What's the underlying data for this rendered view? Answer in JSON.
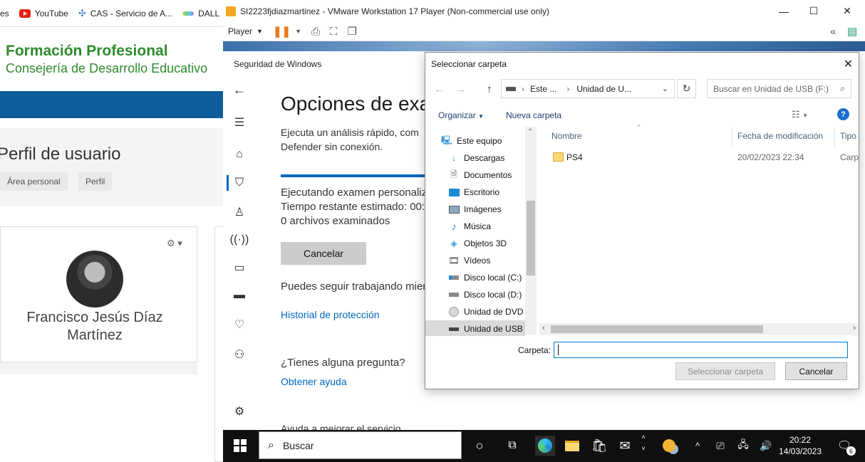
{
  "browser": {
    "bookmarks": [
      {
        "label": "es",
        "icon": "none",
        "color": ""
      },
      {
        "label": "YouTube",
        "icon": "youtube-icon",
        "color": "#e62117"
      },
      {
        "label": "CAS - Servicio de A...",
        "icon": "cas-icon",
        "color": "#3a7bd5"
      },
      {
        "label": "DALL",
        "icon": "dall-icon",
        "color": "#f2c94c"
      }
    ],
    "org_title": "Formación Profesional",
    "org_subtitle": "Consejería de Desarrollo Educativo",
    "page_title": "Perfil de usuario",
    "breadcrumb": [
      "Área personal",
      "Perfil"
    ],
    "user_name": "Francisco Jesús Díaz Martínez",
    "brand_color": "#2e8b2e",
    "nav_color": "#0f5c9c"
  },
  "vmware": {
    "title": "SI2223fjdiazmartinez - VMware Workstation 17 Player (Non-commercial use only)",
    "player_menu": "Player",
    "controls": {
      "minimize": "—",
      "maximize": "☐",
      "close": "✕"
    },
    "collapse_icon": "«"
  },
  "winsec": {
    "window_title": "Seguridad de Windows",
    "heading": "Opciones de exam",
    "description_line1": "Ejecuta un análisis rápido, com",
    "description_line2": "Defender sin conexión.",
    "status_line1": "Ejecutando examen personaliz",
    "status_line2": "Tiempo restante estimado: 00:0",
    "status_line3": "0  archivos examinados",
    "cancel_button": "Cancelar",
    "continue_text": "Puedes seguir trabajando mien",
    "history_link": "Historial de protección",
    "question": "¿Tienes alguna pregunta?",
    "help_link": "Obtener ayuda",
    "improve_text": "Ayuda a mejorar el servicio",
    "accent": "#0067c0"
  },
  "dialog": {
    "title": "Seleccionar carpeta",
    "address": {
      "drive_icon": "usb-drive-icon",
      "seg1": "Este ...",
      "seg2": "Unidad de U..."
    },
    "search_placeholder": "Buscar en Unidad de USB (F:)",
    "organize": "Organizar",
    "new_folder": "Nueva carpeta",
    "help": "?",
    "nav_items": [
      {
        "label": "Este equipo",
        "icon": "pc-icon"
      },
      {
        "label": "Descargas",
        "icon": "downloads-icon"
      },
      {
        "label": "Documentos",
        "icon": "documents-icon"
      },
      {
        "label": "Escritorio",
        "icon": "desktop-icon"
      },
      {
        "label": "Imágenes",
        "icon": "pictures-icon"
      },
      {
        "label": "Música",
        "icon": "music-icon"
      },
      {
        "label": "Objetos 3D",
        "icon": "3d-objects-icon"
      },
      {
        "label": "Vídeos",
        "icon": "videos-icon"
      },
      {
        "label": "Disco local (C:)",
        "icon": "disk-icon"
      },
      {
        "label": "Disco local (D:)",
        "icon": "disk-icon"
      },
      {
        "label": "Unidad de DVD (",
        "icon": "dvd-icon"
      },
      {
        "label": "Unidad de USB (",
        "icon": "usb-drive-icon"
      }
    ],
    "columns": {
      "name": "Nombre",
      "modified": "Fecha de modificación",
      "type": "Tipo"
    },
    "files": [
      {
        "name": "PS4",
        "modified": "20/02/2023 22:34",
        "type": "Carpe"
      }
    ],
    "folder_label": "Carpeta:",
    "folder_value": "",
    "select_button": "Seleccionar carpeta",
    "cancel_button": "Cancelar"
  },
  "taskbar": {
    "search_placeholder": "Buscar",
    "time": "20:22",
    "date": "14/03/2023",
    "notifications": "6"
  }
}
